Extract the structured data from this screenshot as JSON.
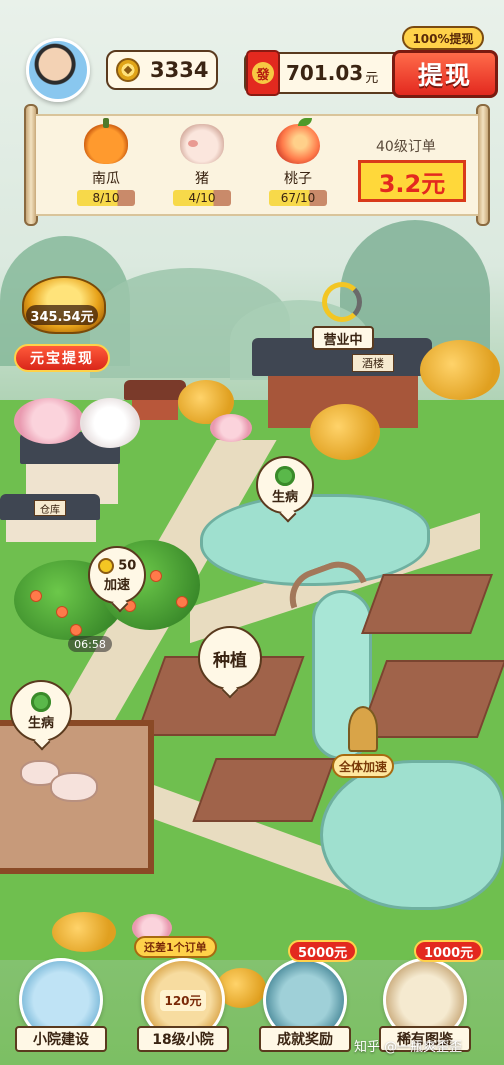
{
  "top_bar": {
    "coins": "3334",
    "money_value": "701.03",
    "money_unit": "元",
    "hongbao_char": "發",
    "withdraw_label": "提现",
    "withdraw_tag": "100%提现"
  },
  "order": {
    "items": [
      {
        "name": "南瓜",
        "count": "8/10",
        "icon": "pumpkin-icon"
      },
      {
        "name": "猪",
        "count": "4/10",
        "icon": "pig-icon"
      },
      {
        "name": "桃子",
        "count": "67/10",
        "icon": "peach-icon"
      }
    ],
    "level_label": "40级订单",
    "reward": "3.2元"
  },
  "yuanbao": {
    "amount": "345.54元",
    "button_label": "元宝提现"
  },
  "scene": {
    "shop_status": "营业中",
    "sick_label_1": "生病",
    "sick_label_2": "生病",
    "speed_cost": "50",
    "speed_label": "加速",
    "timer": "06:58",
    "plant_label": "种植",
    "accel_all_label": "全体加速",
    "shop_sign": "酒楼",
    "warehouse_sign": "仓库"
  },
  "bottom_nav": {
    "items": [
      {
        "label": "小院建设",
        "badge": "",
        "icon": "courtyard-build-icon"
      },
      {
        "label": "18级小院",
        "badge": "还差1个订单",
        "icon": "courtyard-level-icon",
        "inner": "120元"
      },
      {
        "label": "成就奖励",
        "badge": "5000元",
        "icon": "achievement-reward-icon"
      },
      {
        "label": "稀有图鉴",
        "badge": "1000元",
        "icon": "rare-collection-icon"
      }
    ]
  },
  "watermark": "知乎 @一瓶爽歪歪",
  "colors": {
    "primary_red": "#e3291f",
    "gold": "#f3c623",
    "dark_brown": "#3a2412",
    "paper": "#fff8e6"
  }
}
